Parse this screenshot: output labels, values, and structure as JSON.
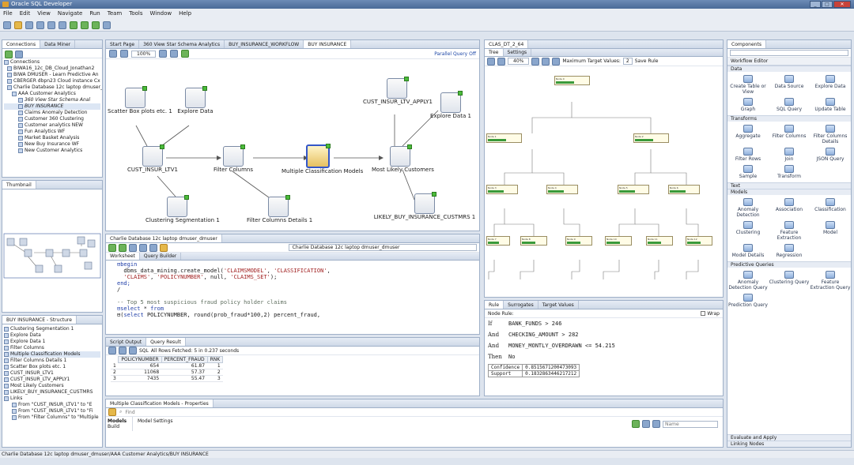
{
  "app": {
    "title": "Oracle SQL Developer"
  },
  "menu": [
    "File",
    "Edit",
    "View",
    "Navigate",
    "Run",
    "Team",
    "Tools",
    "Window",
    "Help"
  ],
  "connections": {
    "tabs": [
      "Connections",
      "Data Miner"
    ],
    "items": [
      "Connections",
      "BIWA16_12c_DB_Cloud_Jonathan2",
      "BIWA DMUSER - Learn Predictive An",
      "CBERGER dbpn23 Cloud instance Cx",
      "Charlie Database 12c laptop dmuser_",
      "AAA Customer Analytics",
      "360 View Star Schema Anal",
      "BUY INSURANCE",
      "Claims Anomaly Detection",
      "Customer 360 Clustering",
      "Customer analytics NEW",
      "Fun Analytics WF",
      "Market Basket Analysis",
      "New Buy Insurance WF",
      "New Customer Analytics"
    ]
  },
  "thumbnail": {
    "title": "Thumbnail"
  },
  "structure": {
    "title": "BUY INSURANCE - Structure",
    "items": [
      "Clustering Segmentation 1",
      "Explore Data",
      "Explore Data 1",
      "Filter Columns",
      "Multiple Classification Models",
      "Filter Columns Details 1",
      "Scatter Box plots etc. 1",
      "CUST_INSUR_LTV1",
      "CUST_INSUR_LTV_APPLY1",
      "Most Likely Customers",
      "LIKELY_BUY_INSURANCE_CUSTMRS",
      "Links",
      "From \"CUST_INSUR_LTV1\" to \"E",
      "From \"CUST_INSUR_LTV1\" to \"Fi",
      "From \"Filter Columns\" to \"Multiple"
    ]
  },
  "workflow": {
    "tabs": [
      "Start Page",
      "360 View Star Schema Analytics",
      "BUY_INSURANCE_WORKFLOW",
      "BUY INSURANCE"
    ],
    "zoom": "100%",
    "parallel": "Parallel Query Off",
    "nodes": {
      "scatter": "Scatter Box plots etc. 1",
      "explore": "Explore Data",
      "apply": "CUST_INSUR_LTV_APPLY1",
      "explore1": "Explore Data 1",
      "source": "CUST_INSUR_LTV1",
      "filter": "Filter Columns",
      "mcm": "Multiple Classification Models",
      "likely": "Most Likely Customers",
      "cluster": "Clustering Segmentation 1",
      "fcd": "Filter Columns Details 1",
      "likelytbl": "LIKELY_BUY_INSURANCE_CUSTMRS 1"
    }
  },
  "worksheet": {
    "connTab": "Charlie Database 12c laptop dmuser_dmuser",
    "conn": "Charlie Database 12c laptop dmuser_dmuser",
    "subtabs": [
      "Worksheet",
      "Query Builder"
    ]
  },
  "results": {
    "tabs": [
      "Script Output",
      "Query Result"
    ],
    "sqlLabel": "SQL",
    "status": "All Rows Fetched: 5 in 0.237 seconds",
    "columns": [
      "POLICYNUMBER",
      "PERCENT_FRAUD",
      "RNK"
    ],
    "rows": [
      [
        "1",
        "654",
        "61.87",
        "1"
      ],
      [
        "2",
        "11068",
        "57.37",
        "2"
      ],
      [
        "3",
        "7435",
        "55.47",
        "3"
      ]
    ]
  },
  "properties": {
    "title": "Multiple Classification Models - Properties",
    "find": "Find",
    "models": "Models",
    "build": "Build",
    "settings": "Model Settings",
    "name": "Name"
  },
  "tree": {
    "tab": "CLAS_DT_2_64",
    "subtabs": [
      "Tree",
      "Settings"
    ],
    "zoom": "40%",
    "maxLabel": "Maximum Target Values:",
    "maxVal": "2",
    "saveLabel": "Save Rule"
  },
  "rule": {
    "tabs": [
      "Rule",
      "Surrogates",
      "Target Values"
    ],
    "header": "Node Rule:",
    "wrap": "Wrap",
    "lines": [
      [
        "If",
        "BANK_FUNDS > 246"
      ],
      [
        "And",
        "CHECKING_AMOUNT > 282"
      ],
      [
        "And",
        "MONEY_MONTLY_OVERDRAWN <= 54.215"
      ],
      [
        "Then",
        "No"
      ]
    ],
    "confidenceLabel": "Confidence",
    "confidence": "0.8515671200473093",
    "supportLabel": "Support",
    "support": "0.1832863446217212"
  },
  "components": {
    "title": "Components",
    "editor": "Workflow Editor",
    "sections": {
      "data": {
        "title": "Data",
        "items": [
          "Create Table or View",
          "Data Source",
          "Explore Data",
          "Graph",
          "SQL Query",
          "Update Table"
        ]
      },
      "transforms": {
        "title": "Transforms",
        "items": [
          "Aggregate",
          "Filter Columns",
          "Filter Columns Details",
          "Filter Rows",
          "Join",
          "JSON Query",
          "Sample",
          "Transform"
        ]
      },
      "text": {
        "title": "Text"
      },
      "models": {
        "title": "Models",
        "items": [
          "Anomaly Detection",
          "Association",
          "Classification",
          "Clustering",
          "Feature Extraction",
          "Model",
          "Model Details",
          "Regression"
        ]
      },
      "predictive": {
        "title": "Predictive Queries",
        "items": [
          "Anomaly Detection Query",
          "Clustering Query",
          "Feature Extraction Query",
          "Prediction Query"
        ]
      }
    },
    "footer1": "Evaluate and Apply",
    "footer2": "Linking Nodes"
  },
  "status": "Charlie Database 12c laptop dmuser_dmuser/AAA Customer Analytics/BUY INSURANCE"
}
